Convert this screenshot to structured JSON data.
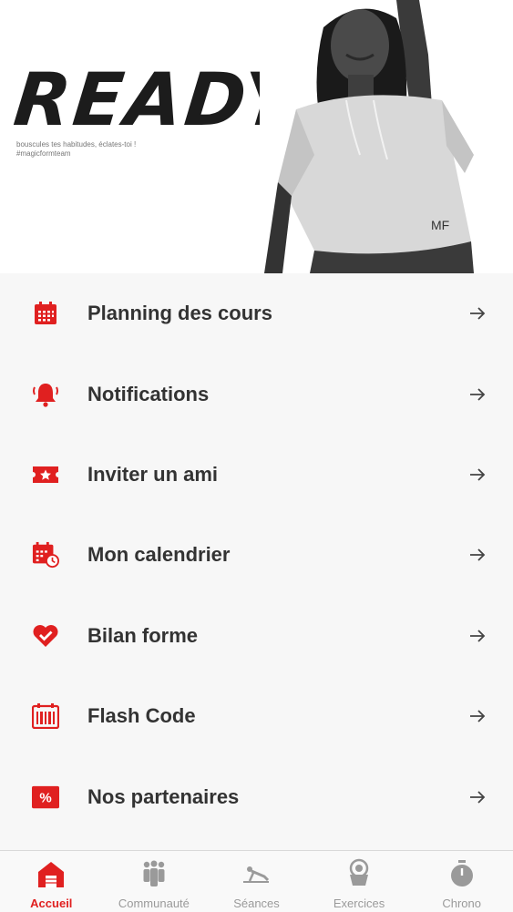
{
  "hero": {
    "title": "READY",
    "subtitle_line1": "bouscules tes habitudes, éclates-toi !",
    "subtitle_line2": "#magicformteam",
    "shirt_logo": "MF"
  },
  "menu": {
    "items": [
      {
        "label": "Planning des cours",
        "icon": "calendar-grid-icon"
      },
      {
        "label": "Notifications",
        "icon": "bell-icon"
      },
      {
        "label": "Inviter un ami",
        "icon": "ticket-star-icon"
      },
      {
        "label": "Mon calendrier",
        "icon": "calendar-clock-icon"
      },
      {
        "label": "Bilan forme",
        "icon": "heart-check-icon"
      },
      {
        "label": "Flash Code",
        "icon": "barcode-icon"
      },
      {
        "label": "Nos partenaires",
        "icon": "percent-tag-icon"
      }
    ]
  },
  "tabbar": {
    "tabs": [
      {
        "label": "Accueil",
        "icon": "home-icon",
        "active": true
      },
      {
        "label": "Communauté",
        "icon": "community-icon",
        "active": false
      },
      {
        "label": "Séances",
        "icon": "sessions-icon",
        "active": false
      },
      {
        "label": "Exercices",
        "icon": "exercises-icon",
        "active": false
      },
      {
        "label": "Chrono",
        "icon": "stopwatch-icon",
        "active": false
      }
    ]
  },
  "colors": {
    "accent": "#e02020",
    "inactive": "#9a9a9a",
    "text": "#333333",
    "background": "#f7f7f7"
  }
}
